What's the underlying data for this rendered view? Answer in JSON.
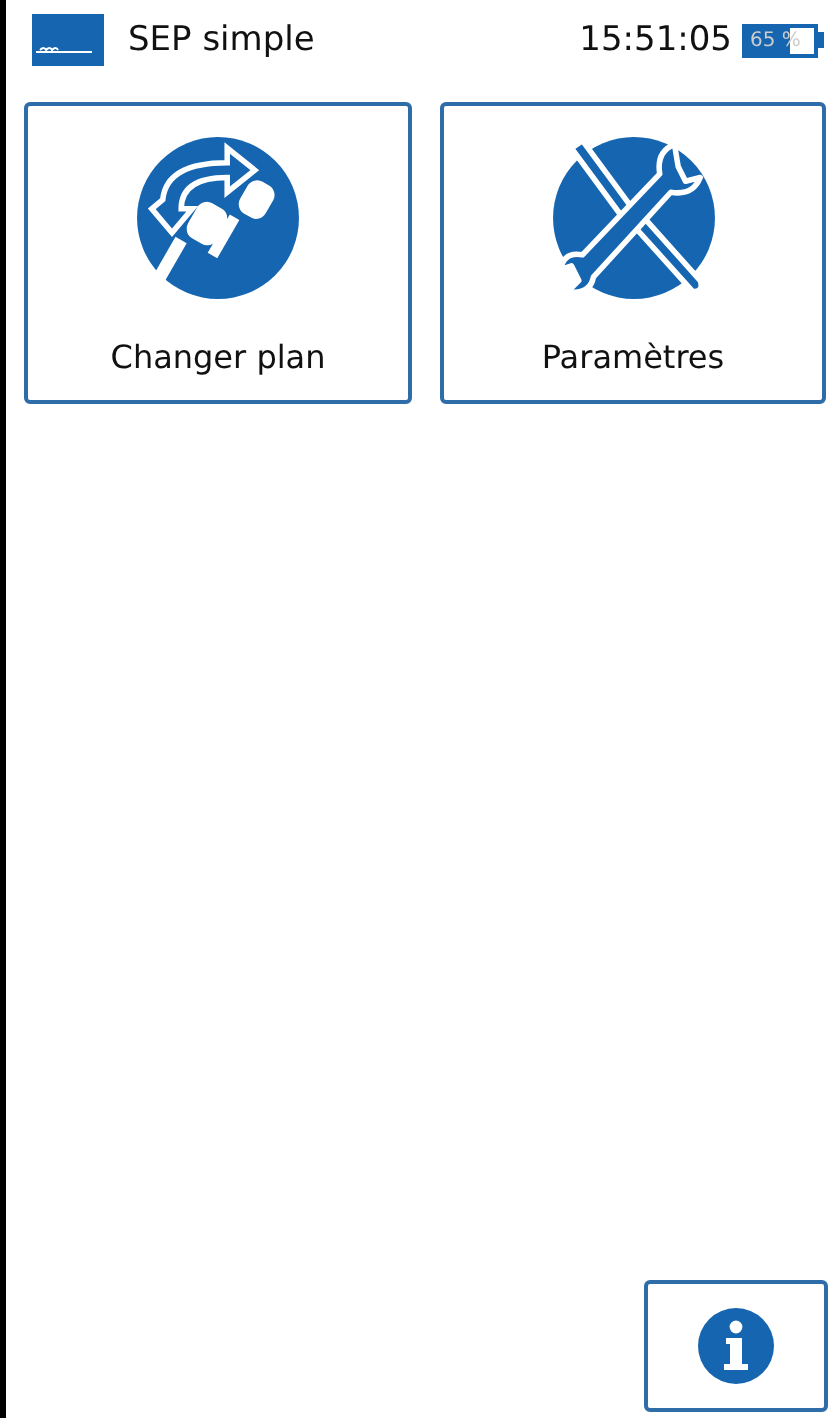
{
  "header": {
    "title": "SEP simple",
    "time": "15:51:05",
    "battery": {
      "level": 0.65,
      "reading": "65 %"
    }
  },
  "tiles": [
    {
      "kind": "keys",
      "label": "Changer plan"
    },
    {
      "kind": "tools",
      "label": "Paramètres"
    }
  ],
  "info_button": {
    "kind": "info"
  }
}
